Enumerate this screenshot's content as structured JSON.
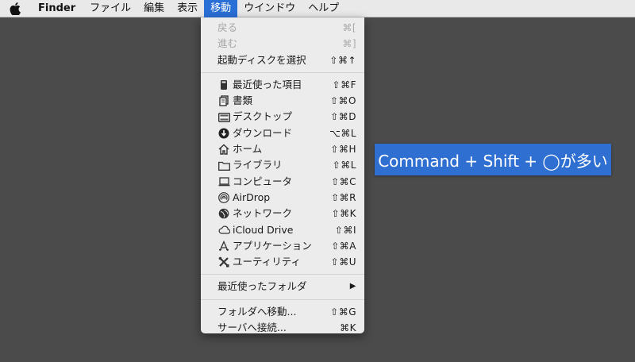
{
  "menubar": {
    "apple_icon": "apple-logo-icon",
    "app_name": "Finder",
    "items": [
      "ファイル",
      "編集",
      "表示",
      "移動",
      "ウインドウ",
      "ヘルプ"
    ],
    "active": "移動"
  },
  "menu": {
    "back": {
      "label": "戻る",
      "shortcut": "⌘["
    },
    "forward": {
      "label": "進む",
      "shortcut": "⌘]"
    },
    "startup_disk": {
      "label": "起動ディスクを選択",
      "shortcut": "⇧⌘↑"
    },
    "recents": {
      "label": "最近使った項目",
      "shortcut": "⇧⌘F",
      "icon": "recents-icon"
    },
    "documents": {
      "label": "書類",
      "shortcut": "⇧⌘O",
      "icon": "documents-icon"
    },
    "desktop": {
      "label": "デスクトップ",
      "shortcut": "⇧⌘D",
      "icon": "desktop-icon"
    },
    "downloads": {
      "label": "ダウンロード",
      "shortcut": "⌥⌘L",
      "icon": "download-icon"
    },
    "home": {
      "label": "ホーム",
      "shortcut": "⇧⌘H",
      "icon": "home-icon"
    },
    "library": {
      "label": "ライブラリ",
      "shortcut": "⇧⌘L",
      "icon": "folder-icon"
    },
    "computer": {
      "label": "コンピュータ",
      "shortcut": "⇧⌘C",
      "icon": "laptop-icon"
    },
    "airdrop": {
      "label": "AirDrop",
      "shortcut": "⇧⌘R",
      "icon": "airdrop-icon"
    },
    "network": {
      "label": "ネットワーク",
      "shortcut": "⇧⌘K",
      "icon": "globe-icon"
    },
    "icloud": {
      "label": "iCloud Drive",
      "shortcut": "⇧⌘I",
      "icon": "cloud-icon"
    },
    "applications": {
      "label": "アプリケーション",
      "shortcut": "⇧⌘A",
      "icon": "applications-icon"
    },
    "utilities": {
      "label": "ユーティリティ",
      "shortcut": "⇧⌘U",
      "icon": "tools-icon"
    },
    "recent_folders": {
      "label": "最近使ったフォルダ",
      "submenu_arrow": "▶"
    },
    "go_to_folder": {
      "label": "フォルダへ移動...",
      "shortcut": "⇧⌘G"
    },
    "connect_server": {
      "label": "サーバへ接続...",
      "shortcut": "⌘K"
    }
  },
  "callout": {
    "text": "Command + Shift + ◯が多い"
  },
  "colors": {
    "accent": "#2a6fd6",
    "desktop_bg": "#4b4b4b",
    "menu_bg": "#ececec"
  }
}
